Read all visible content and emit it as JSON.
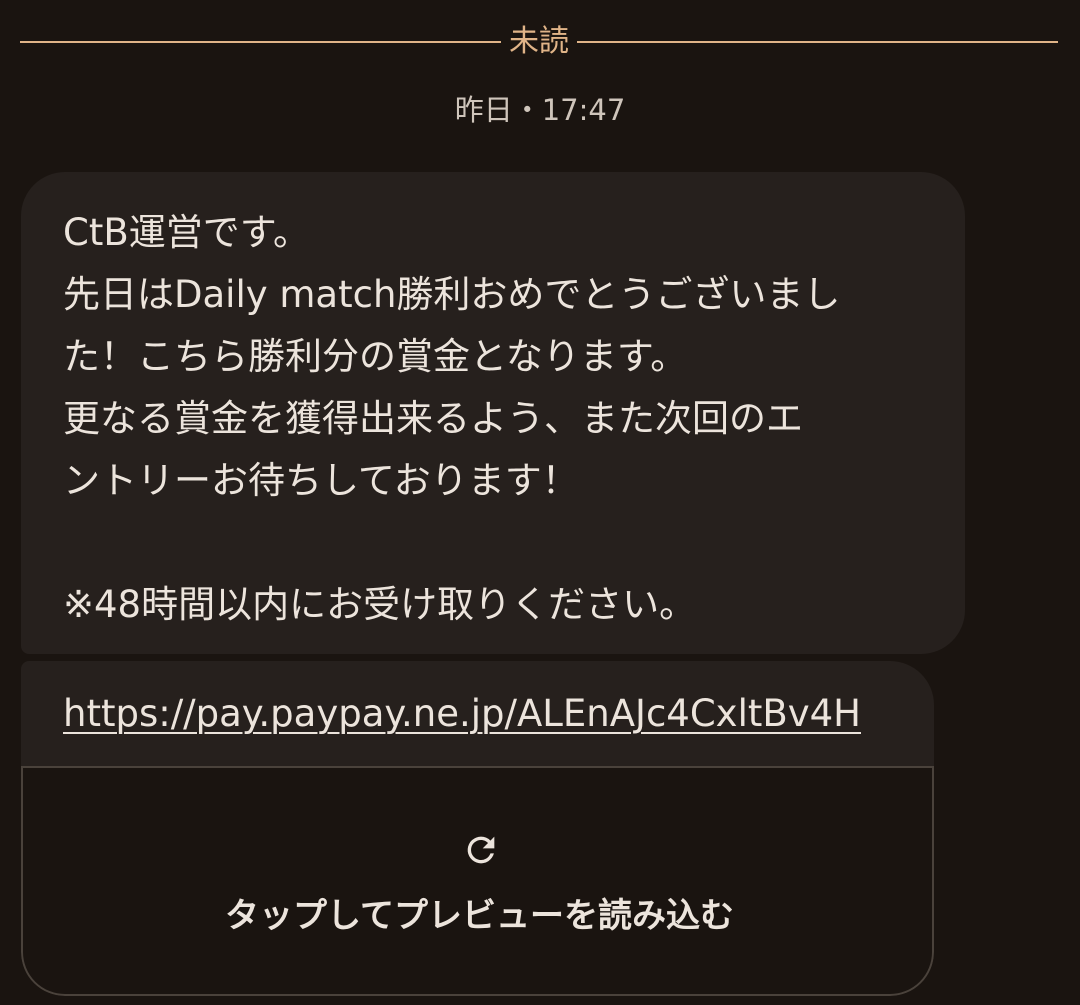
{
  "unread_divider": {
    "label": "未読"
  },
  "timestamp": "昨日・17:47",
  "message": {
    "lines": [
      "CtB運営です。",
      "先日はDaily match勝利おめでとうございまし",
      "た！こちら勝利分の賞金となります。",
      "更なる賞金を獲得出来るよう、また次回のエ",
      "ントリーお待ちしております！",
      "",
      "※48時間以内にお受け取りください。"
    ]
  },
  "link_card": {
    "url": "https://pay.paypay.ne.jp/ALEnAJc4CxltBv4H",
    "preview_label": "タップしてプレビューを読み込む",
    "icon": "refresh-icon"
  },
  "colors": {
    "background": "#1a1410",
    "bubble": "#26201d",
    "accent": "#e0b488",
    "text": "#ece4dc"
  }
}
